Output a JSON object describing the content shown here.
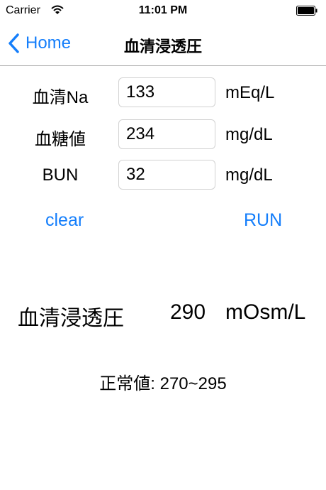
{
  "status_bar": {
    "carrier": "Carrier",
    "time": "11:01 PM"
  },
  "nav": {
    "back_label": "Home",
    "title": "血清浸透圧"
  },
  "form": {
    "rows": [
      {
        "label": "血清Na",
        "value": "133",
        "unit": "mEq/L"
      },
      {
        "label": "血糖値",
        "value": "234",
        "unit": "mg/dL"
      },
      {
        "label": "BUN",
        "value": "32",
        "unit": "mg/dL"
      }
    ]
  },
  "actions": {
    "clear_label": "clear",
    "run_label": "RUN"
  },
  "result": {
    "label": "血清浸透圧",
    "value": "290",
    "unit": "mOsm/L"
  },
  "normal": {
    "text": "正常値: 270~295"
  },
  "colors": {
    "accent": "#147efb",
    "separator": "#b2b2b2",
    "input_border": "#d2d2d2"
  },
  "icons": {
    "wifi": "wifi-icon",
    "battery": "battery-icon",
    "back": "chevron-left-icon"
  }
}
